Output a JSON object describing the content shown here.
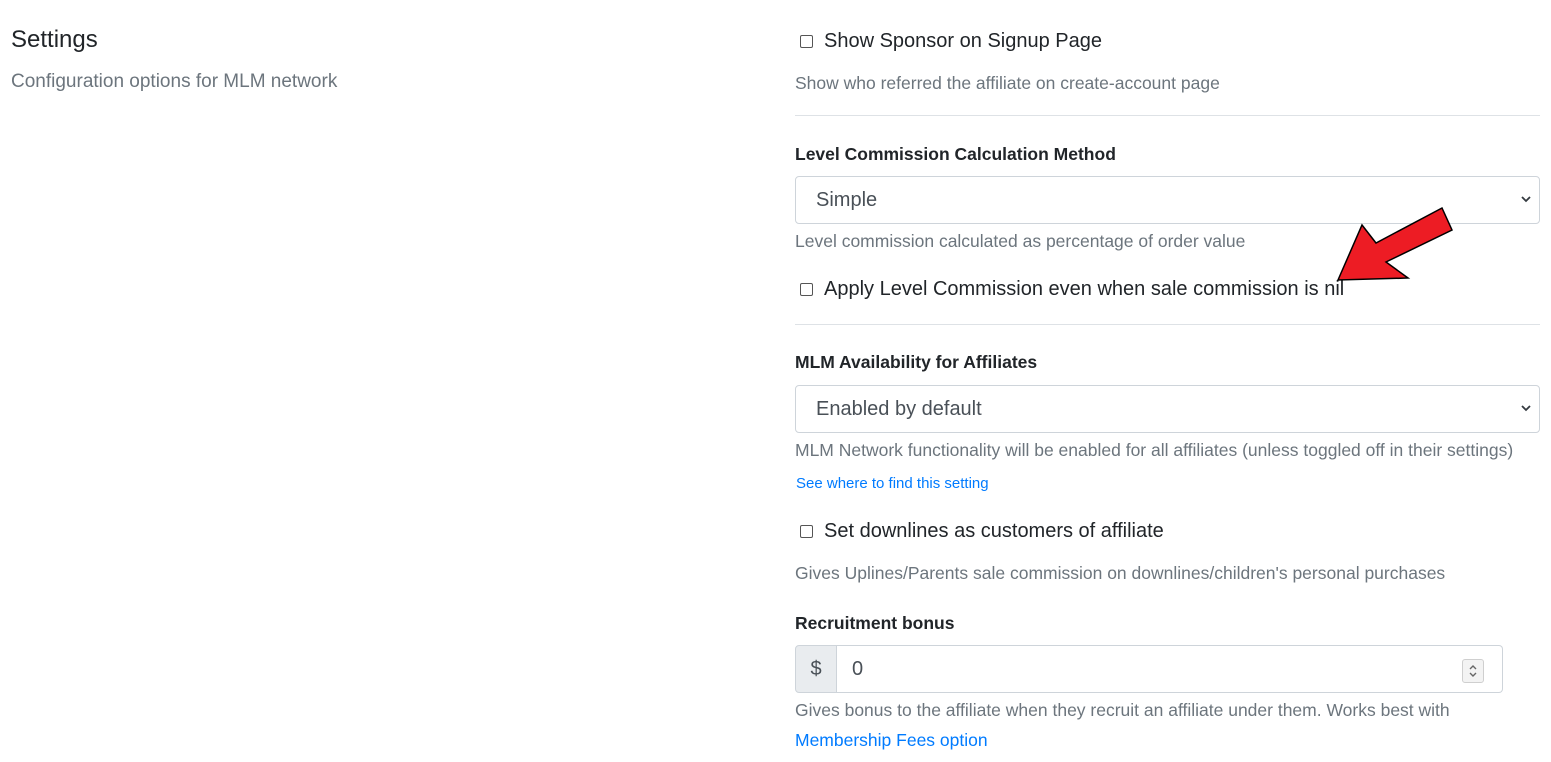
{
  "header": {
    "title": "Settings",
    "subtitle": "Configuration options for MLM network"
  },
  "show_sponsor": {
    "label": "Show Sponsor on Signup Page",
    "help": "Show who referred the affiliate on create-account page",
    "checked": false
  },
  "level_commission": {
    "label": "Level Commission Calculation Method",
    "selected": "Simple",
    "help": "Level commission calculated as percentage of order value"
  },
  "apply_level_commission": {
    "label": "Apply Level Commission even when sale commission is nil",
    "checked": false
  },
  "mlm_availability": {
    "label": "MLM Availability for Affiliates",
    "selected": "Enabled by default",
    "help": "MLM Network functionality will be enabled for all affiliates (unless toggled off in their settings)",
    "link": "See where to find this setting"
  },
  "downlines": {
    "label": "Set downlines as customers of affiliate",
    "help": "Gives Uplines/Parents sale commission on downlines/children's personal purchases",
    "checked": false
  },
  "recruitment_bonus": {
    "label": "Recruitment bonus",
    "currency": "$",
    "value": "0",
    "help": "Gives bonus to the affiliate when they recruit an affiliate under them. Works best with",
    "link": "Membership Fees option"
  },
  "colors": {
    "arrow": "#ed1c24",
    "link": "#007bff",
    "muted": "#6c757d"
  }
}
